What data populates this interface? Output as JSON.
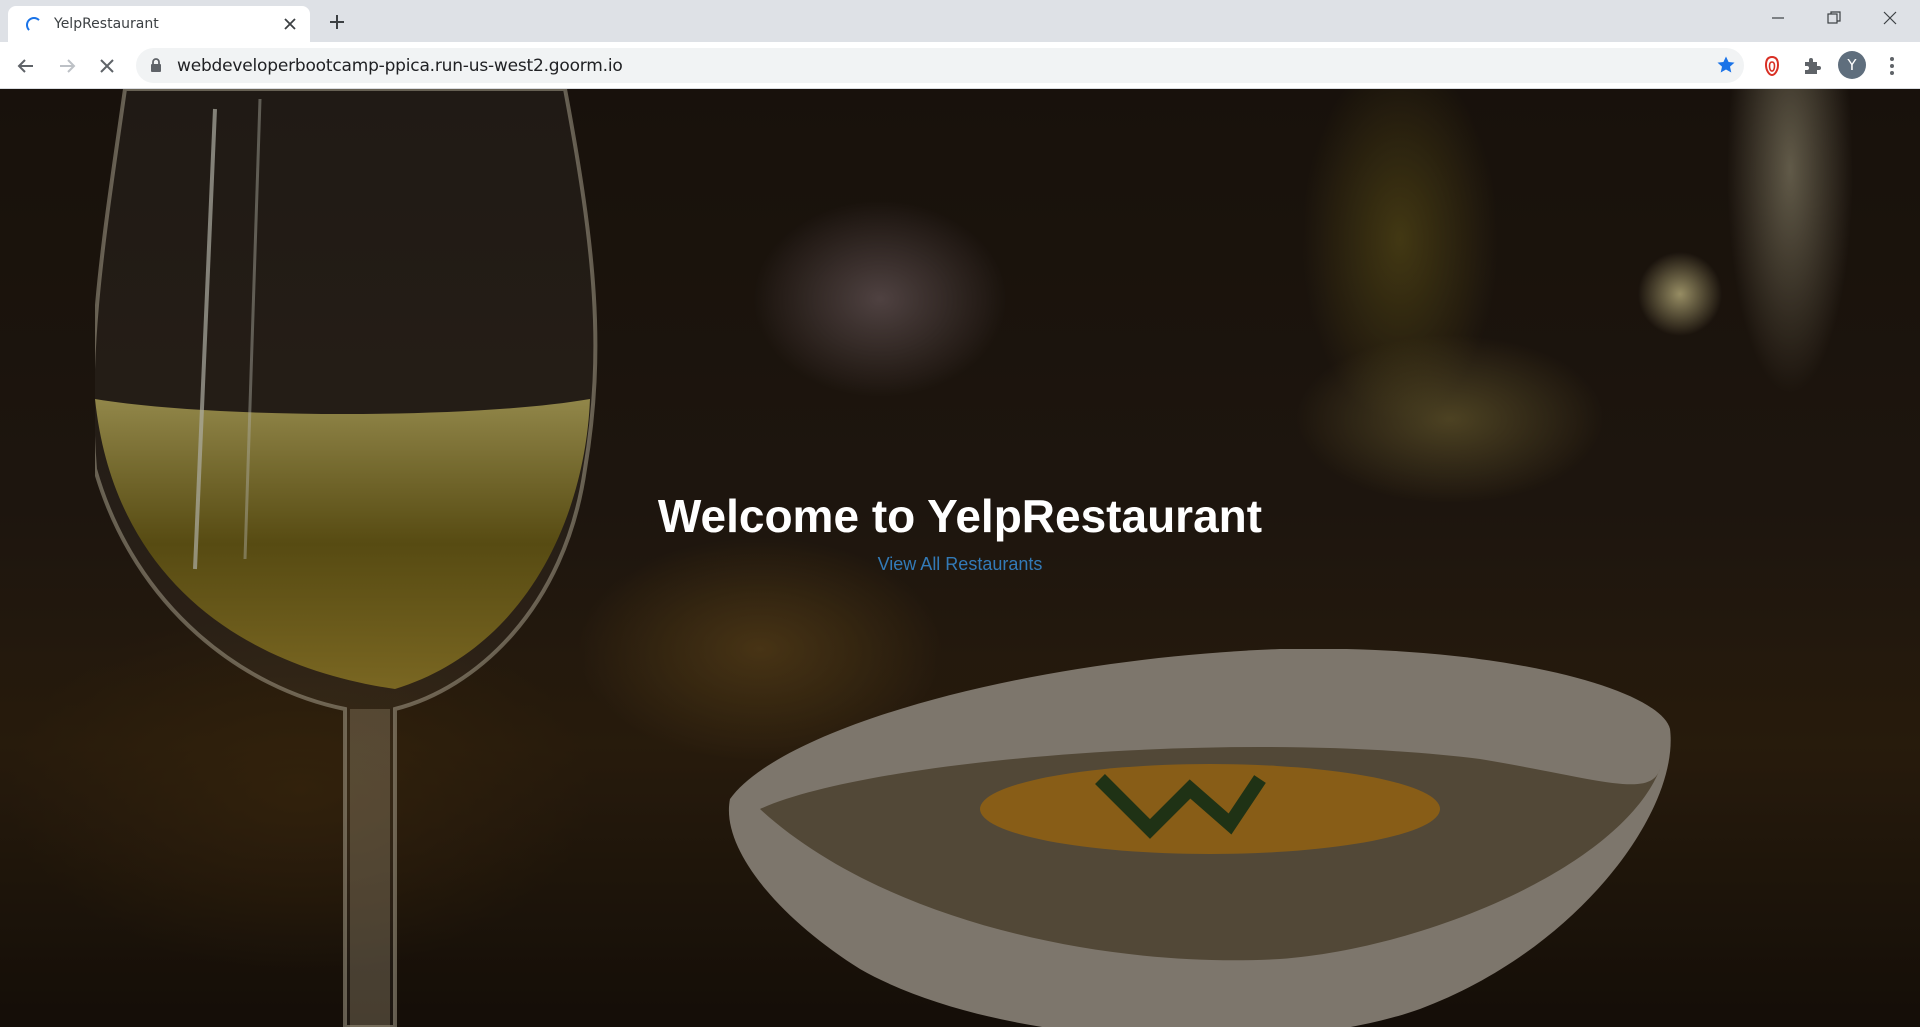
{
  "browser": {
    "tab": {
      "title": "YelpRestaurant",
      "loading": true
    },
    "address_bar": {
      "url": "webdeveloperbootcamp-ppica.run-us-west2.goorm.io"
    },
    "profile_initial": "Y",
    "icons": {
      "back": "arrow-left-icon",
      "forward": "arrow-right-icon",
      "stop": "close-icon",
      "lock": "lock-icon",
      "bookmark": "star-icon",
      "extension_red": "red-extension-icon",
      "extensions": "puzzle-icon",
      "menu": "kebab-menu-icon",
      "new_tab": "plus-icon",
      "minimize": "minimize-icon",
      "restore": "restore-icon",
      "close_window": "close-icon"
    },
    "colors": {
      "bookmark_star": "#1a73e8",
      "extension_red": "#d93025"
    }
  },
  "page": {
    "hero": {
      "title": "Welcome to YelpRestaurant",
      "link_label": "View All Restaurants"
    },
    "colors": {
      "title": "#ffffff",
      "link": "#337ab7"
    }
  }
}
